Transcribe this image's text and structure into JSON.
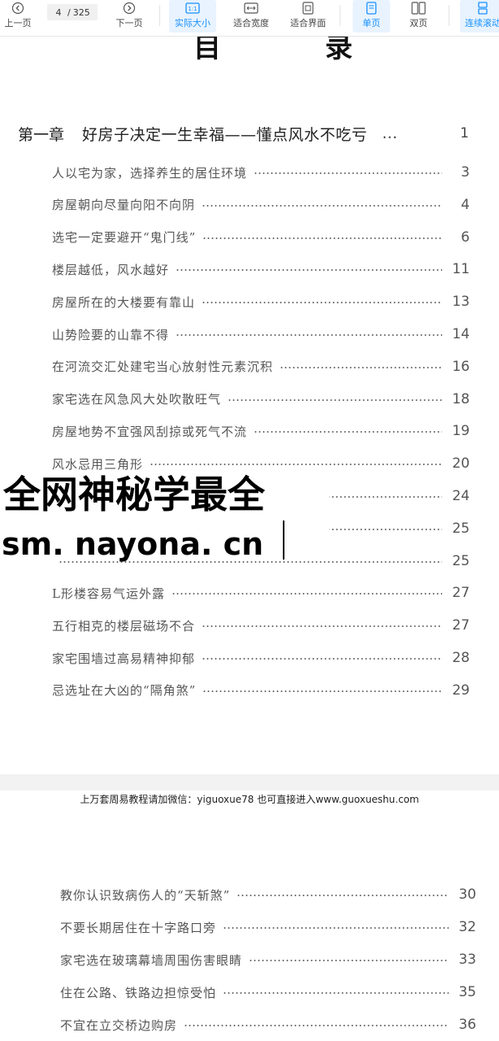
{
  "toolbar": {
    "prev_label": "上一页",
    "prev_icon": "chevron-left-circle-icon",
    "current_page": "4",
    "total_pages": "325",
    "page_sep": "/",
    "next_label": "下一页",
    "next_icon": "chevron-right-circle-icon",
    "actual_size_label": "实际大小",
    "actual_size_icon": "one-to-one-icon",
    "fit_width_label": "适合宽度",
    "fit_width_icon": "fit-width-icon",
    "fit_page_label": "适合界面",
    "fit_page_icon": "fit-page-icon",
    "single_page_label": "单页",
    "single_page_icon": "single-page-icon",
    "double_page_label": "双页",
    "double_page_icon": "double-page-icon",
    "continuous_label": "连续滚动",
    "continuous_icon": "continuous-scroll-icon",
    "accent": "#1890ff"
  },
  "page1": {
    "title": "目 录",
    "chapter": {
      "num": "第一章",
      "title": "好房子决定一生幸福——懂点风水不吃亏",
      "dots": "…",
      "page": "1"
    },
    "entries": [
      {
        "text": "人以宅为家，选择养生的居住环境",
        "page": "3"
      },
      {
        "text": "房屋朝向尽量向阳不向阴",
        "page": "4"
      },
      {
        "text": "选宅一定要避开“鬼门线”",
        "page": "6"
      },
      {
        "text": "楼层越低，风水越好",
        "page": "11"
      },
      {
        "text": "房屋所在的大楼要有靠山",
        "page": "13"
      },
      {
        "text": "山势险要的山靠不得",
        "page": "14"
      },
      {
        "text": "在河流交汇处建宅当心放射性元素沉积",
        "page": "16"
      },
      {
        "text": "家宅选在风急风大处吹散旺气",
        "page": "18"
      },
      {
        "text": "房屋地势不宜强风刮掠或死气不流",
        "page": "19"
      },
      {
        "text": "风水忌用三角形",
        "page": "20"
      },
      {
        "text": "",
        "page": "24"
      },
      {
        "text": "",
        "page": "25"
      },
      {
        "text": "",
        "page": "25"
      },
      {
        "text": "L形楼容易气运外露",
        "page": "27"
      },
      {
        "text": "五行相克的楼层磁场不合",
        "page": "27"
      },
      {
        "text": "家宅围墙过高易精神抑郁",
        "page": "28"
      },
      {
        "text": "忌选址在大凶的“隔角煞”",
        "page": "29"
      }
    ]
  },
  "watermark": {
    "line1": "全网神秘学最全",
    "line2": "sm. nayona. cn"
  },
  "page2": {
    "header_note": "上万套周易教程请加微信：yiguoxue78   也可直接进入www.guoxueshu.com",
    "entries": [
      {
        "text": "教你认识致病伤人的“天斩煞”",
        "page": "30"
      },
      {
        "text": "不要长期居住在十字路口旁",
        "page": "32"
      },
      {
        "text": "家宅选在玻璃幕墙周围伤害眼睛",
        "page": "33"
      },
      {
        "text": "住在公路、铁路边担惊受怕",
        "page": "35"
      },
      {
        "text": "不宜在立交桥边购房",
        "page": "36"
      }
    ]
  }
}
